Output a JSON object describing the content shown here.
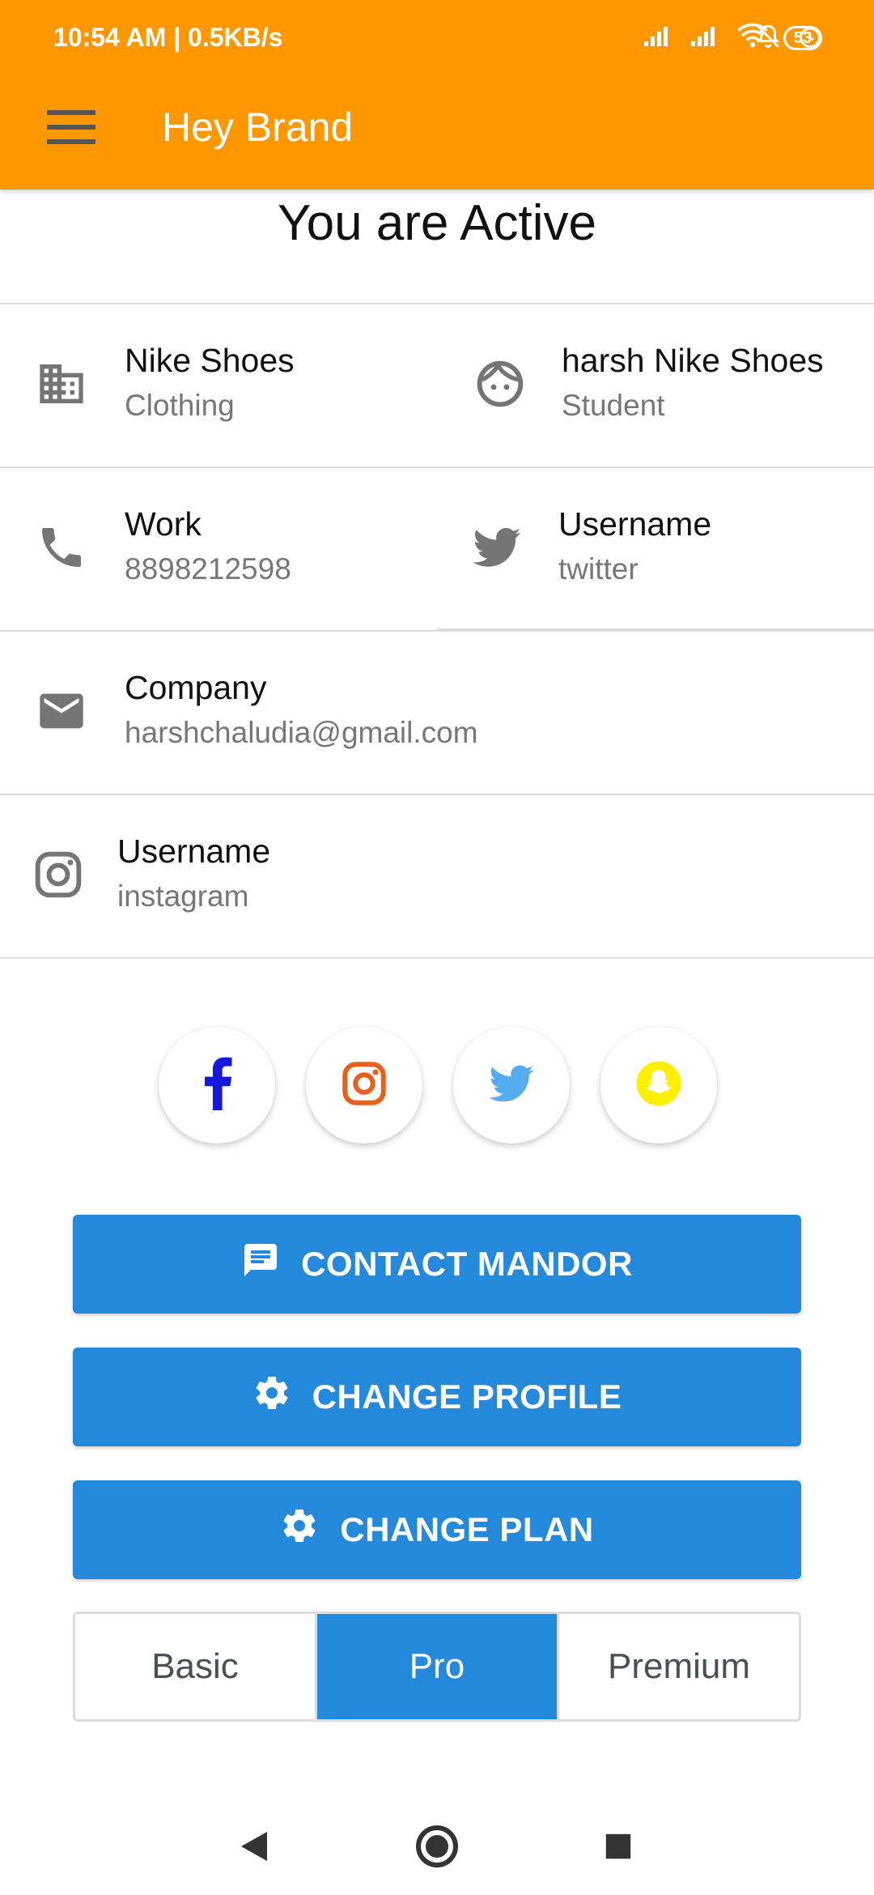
{
  "status_bar": {
    "time": "10:54 AM | 0.5KB/s",
    "battery": "53"
  },
  "app_bar": {
    "title": "Hey Brand"
  },
  "status_title": "You are Active",
  "rows": {
    "brand": {
      "label": "Nike Shoes",
      "sub": "Clothing",
      "icon": "building-icon"
    },
    "owner": {
      "label": "harsh Nike Shoes",
      "sub": "Student",
      "icon": "face-icon"
    },
    "phone": {
      "label": "Work",
      "sub": "8898212598",
      "icon": "phone-icon"
    },
    "twitter": {
      "label": "Username",
      "sub": "twitter",
      "icon": "twitter-icon"
    },
    "email": {
      "label": "Company",
      "sub": "harshchaludia@gmail.com",
      "icon": "email-icon"
    },
    "instagram": {
      "label": "Username",
      "sub": "instagram",
      "icon": "instagram-icon"
    }
  },
  "social_icons": [
    "facebook-icon",
    "instagram-icon",
    "twitter-icon",
    "snapchat-icon"
  ],
  "buttons": {
    "contact": "CONTACT MANDOR",
    "change_profile": "CHANGE PROFILE",
    "change_plan": "CHANGE PLAN"
  },
  "plans": {
    "options": [
      "Basic",
      "Pro",
      "Premium"
    ],
    "selected": "Pro"
  },
  "colors": {
    "app_bar": "#FF9800",
    "primary_button": "#2589DB",
    "facebook": "#1418D8",
    "instagram": "#E8601C",
    "twitter": "#55ACEE",
    "snapchat": "#FFF000"
  }
}
